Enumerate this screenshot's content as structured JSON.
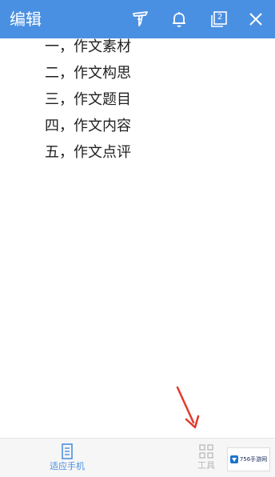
{
  "topbar": {
    "title": "编辑",
    "icons": [
      "highlighter-icon",
      "bell-icon",
      "window-count-icon",
      "close-icon"
    ],
    "window_count": "2"
  },
  "content": {
    "items": [
      "一，作文素材",
      "二，作文构思",
      "三，作文题目",
      "四，作文内容",
      "五，作文点评"
    ]
  },
  "bottombar": {
    "fit_phone_label": "适应手机",
    "tools_label": "工具"
  },
  "watermark": {
    "text": "756手游网"
  },
  "colors": {
    "topbar": "#4a90e2",
    "accent_icon": "#4a90e2",
    "arrow": "#e23a2a"
  }
}
